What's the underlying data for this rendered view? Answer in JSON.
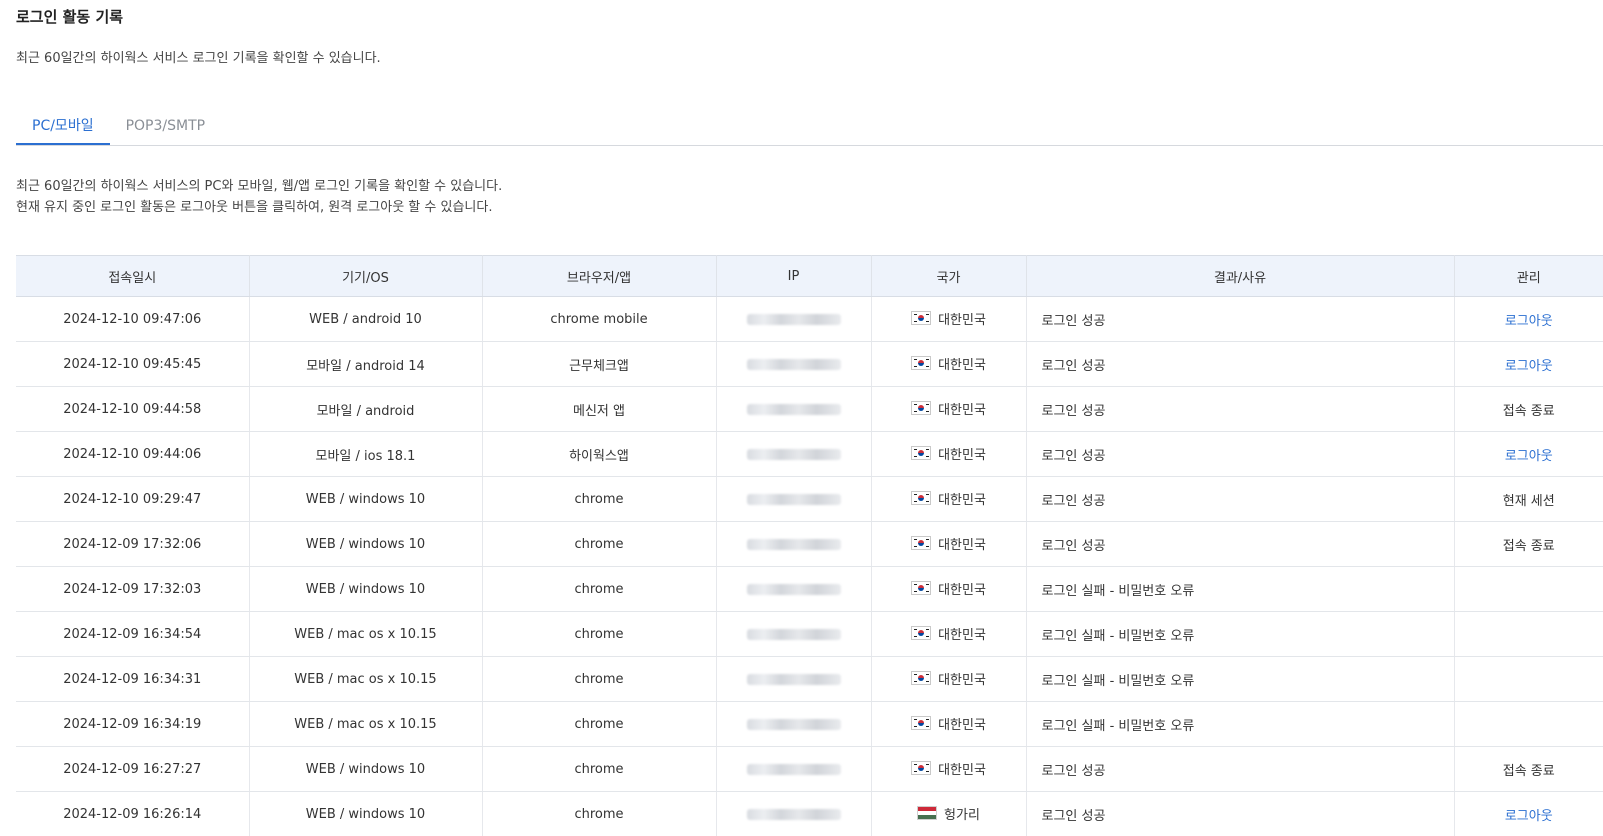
{
  "page": {
    "title": "로그인 활동 기록",
    "description": "최근 60일간의 하이웍스 서비스 로그인 기록을 확인할 수 있습니다."
  },
  "tabs": [
    {
      "label": "PC/모바일",
      "active": true
    },
    {
      "label": "POP3/SMTP",
      "active": false
    }
  ],
  "tab_description": {
    "line1": "최근 60일간의 하이웍스 서비스의 PC와 모바일, 웹/앱 로그인 기록을 확인할 수 있습니다.",
    "line2": "현재 유지 중인 로그인 활동은 로그아웃 버튼을 클릭하여, 원격 로그아웃 할 수 있습니다."
  },
  "colors": {
    "accent": "#2b6fd1",
    "header_bg": "#eef3fb",
    "tab_inactive": "#8a8f96"
  },
  "table": {
    "columns": [
      "접속일시",
      "기기/OS",
      "브라우저/앱",
      "IP",
      "국가",
      "결과/사유",
      "관리"
    ],
    "rows": [
      {
        "datetime": "2024-12-10 09:47:06",
        "device": "WEB / android 10",
        "browser": "chrome mobile",
        "country": "대한민국",
        "flag": "kr",
        "result": "로그인 성공",
        "action": "로그아웃",
        "action_type": "link"
      },
      {
        "datetime": "2024-12-10 09:45:45",
        "device": "모바일 / android 14",
        "browser": "근무체크앱",
        "country": "대한민국",
        "flag": "kr",
        "result": "로그인 성공",
        "action": "로그아웃",
        "action_type": "link"
      },
      {
        "datetime": "2024-12-10 09:44:58",
        "device": "모바일 / android",
        "browser": "메신저 앱",
        "country": "대한민국",
        "flag": "kr",
        "result": "로그인 성공",
        "action": "접속 종료",
        "action_type": "text"
      },
      {
        "datetime": "2024-12-10 09:44:06",
        "device": "모바일 / ios 18.1",
        "browser": "하이웍스앱",
        "country": "대한민국",
        "flag": "kr",
        "result": "로그인 성공",
        "action": "로그아웃",
        "action_type": "link"
      },
      {
        "datetime": "2024-12-10 09:29:47",
        "device": "WEB / windows 10",
        "browser": "chrome",
        "country": "대한민국",
        "flag": "kr",
        "result": "로그인 성공",
        "action": "현재 세션",
        "action_type": "text"
      },
      {
        "datetime": "2024-12-09 17:32:06",
        "device": "WEB / windows 10",
        "browser": "chrome",
        "country": "대한민국",
        "flag": "kr",
        "result": "로그인 성공",
        "action": "접속 종료",
        "action_type": "text"
      },
      {
        "datetime": "2024-12-09 17:32:03",
        "device": "WEB / windows 10",
        "browser": "chrome",
        "country": "대한민국",
        "flag": "kr",
        "result": "로그인 실패 - 비밀번호 오류",
        "action": "",
        "action_type": "text"
      },
      {
        "datetime": "2024-12-09 16:34:54",
        "device": "WEB / mac os x 10.15",
        "browser": "chrome",
        "country": "대한민국",
        "flag": "kr",
        "result": "로그인 실패 - 비밀번호 오류",
        "action": "",
        "action_type": "text"
      },
      {
        "datetime": "2024-12-09 16:34:31",
        "device": "WEB / mac os x 10.15",
        "browser": "chrome",
        "country": "대한민국",
        "flag": "kr",
        "result": "로그인 실패 - 비밀번호 오류",
        "action": "",
        "action_type": "text"
      },
      {
        "datetime": "2024-12-09 16:34:19",
        "device": "WEB / mac os x 10.15",
        "browser": "chrome",
        "country": "대한민국",
        "flag": "kr",
        "result": "로그인 실패 - 비밀번호 오류",
        "action": "",
        "action_type": "text"
      },
      {
        "datetime": "2024-12-09 16:27:27",
        "device": "WEB / windows 10",
        "browser": "chrome",
        "country": "대한민국",
        "flag": "kr",
        "result": "로그인 성공",
        "action": "접속 종료",
        "action_type": "text"
      },
      {
        "datetime": "2024-12-09 16:26:14",
        "device": "WEB / windows 10",
        "browser": "chrome",
        "country": "헝가리",
        "flag": "hu",
        "result": "로그인 성공",
        "action": "로그아웃",
        "action_type": "link"
      }
    ]
  }
}
